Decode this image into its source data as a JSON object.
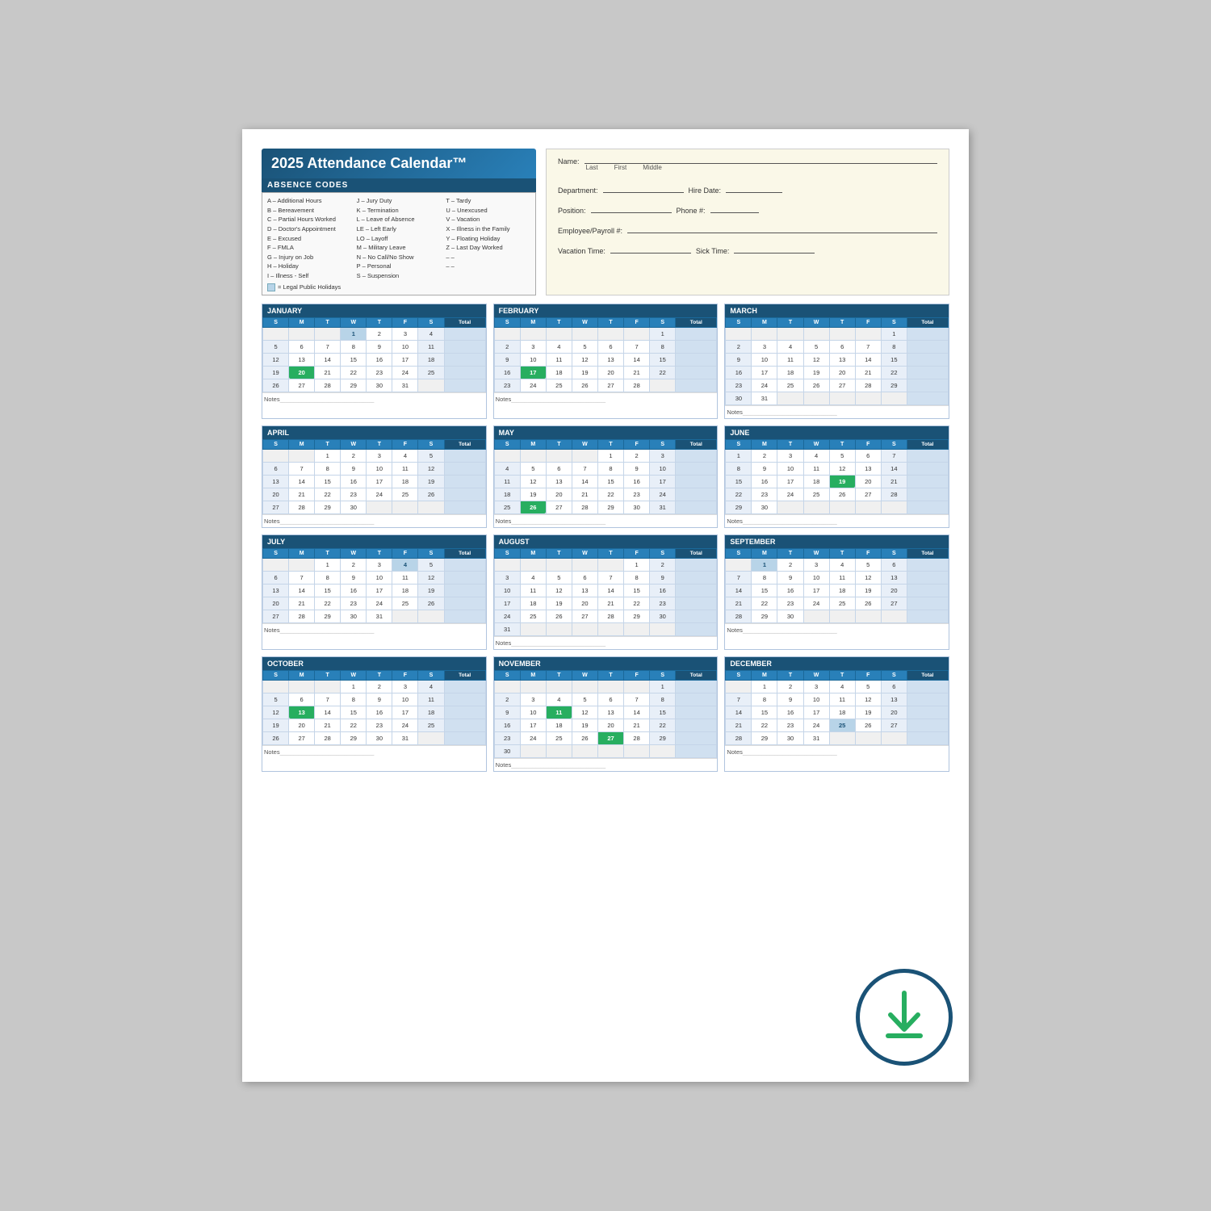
{
  "title": "2025 Attendance Calendar™",
  "absence_codes": {
    "header": "ABSENCE CODES",
    "col1": [
      "A – Additional Hours",
      "B – Bereavement",
      "C – Partial Hours Worked",
      "D – Doctor's Appointment",
      "E – Excused",
      "F – FMLA",
      "G – Injury on Job",
      "H – Holiday",
      "I  – Illness - Self"
    ],
    "col2": [
      "J  – Jury Duty",
      "K – Termination",
      "L  – Leave of Absence",
      "LE – Left Early",
      "LO – Layoff",
      "M – Military Leave",
      "N – No Call/No Show",
      "P  – Personal",
      "S  – Suspension"
    ],
    "col3": [
      "T – Tardy",
      "U – Unexcused",
      "V – Vacation",
      "X – Illness in the Family",
      "Y – Floating Holiday",
      "Z – Last Day Worked",
      "– –",
      "– –"
    ],
    "holiday_note": "= Legal Public Holidays"
  },
  "form": {
    "name_label": "Name:",
    "last_label": "Last",
    "first_label": "First",
    "middle_label": "Middle",
    "dept_label": "Department:",
    "hire_label": "Hire Date:",
    "position_label": "Position:",
    "phone_label": "Phone #:",
    "emp_label": "Employee/Payroll #:",
    "vac_label": "Vacation Time:",
    "sick_label": "Sick Time:"
  },
  "months": [
    {
      "name": "JANUARY",
      "weeks": [
        [
          "",
          "",
          "",
          "1",
          "2",
          "3",
          "4"
        ],
        [
          "5",
          "6",
          "7",
          "8",
          "9",
          "10",
          "11"
        ],
        [
          "12",
          "13",
          "14",
          "15",
          "16",
          "17",
          "18"
        ],
        [
          "19",
          "20",
          "21",
          "22",
          "23",
          "24",
          "25"
        ],
        [
          "26",
          "27",
          "28",
          "29",
          "30",
          "31",
          ""
        ]
      ],
      "highlights": [
        "1"
      ],
      "green_highlights": [
        "20"
      ]
    },
    {
      "name": "FEBRUARY",
      "weeks": [
        [
          "",
          "",
          "",
          "",
          "",
          "",
          "1"
        ],
        [
          "2",
          "3",
          "4",
          "5",
          "6",
          "7",
          "8"
        ],
        [
          "9",
          "10",
          "11",
          "12",
          "13",
          "14",
          "15"
        ],
        [
          "16",
          "17",
          "18",
          "19",
          "20",
          "21",
          "22"
        ],
        [
          "23",
          "24",
          "25",
          "26",
          "27",
          "28",
          ""
        ]
      ],
      "highlights": [],
      "green_highlights": [
        "17"
      ]
    },
    {
      "name": "MARCH",
      "weeks": [
        [
          "",
          "",
          "",
          "",
          "",
          "",
          "1"
        ],
        [
          "2",
          "3",
          "4",
          "5",
          "6",
          "7",
          "8"
        ],
        [
          "9",
          "10",
          "11",
          "12",
          "13",
          "14",
          "15"
        ],
        [
          "16",
          "17",
          "18",
          "19",
          "20",
          "21",
          "22"
        ],
        [
          "23",
          "24",
          "25",
          "26",
          "27",
          "28",
          "29"
        ],
        [
          "30",
          "31",
          "",
          "",
          "",
          "",
          ""
        ]
      ],
      "highlights": [],
      "green_highlights": []
    },
    {
      "name": "APRIL",
      "weeks": [
        [
          "",
          "",
          "1",
          "2",
          "3",
          "4",
          "5"
        ],
        [
          "6",
          "7",
          "8",
          "9",
          "10",
          "11",
          "12"
        ],
        [
          "13",
          "14",
          "15",
          "16",
          "17",
          "18",
          "19"
        ],
        [
          "20",
          "21",
          "22",
          "23",
          "24",
          "25",
          "26"
        ],
        [
          "27",
          "28",
          "29",
          "30",
          "",
          "",
          ""
        ]
      ],
      "highlights": [],
      "green_highlights": []
    },
    {
      "name": "MAY",
      "weeks": [
        [
          "",
          "",
          "",
          "",
          "1",
          "2",
          "3"
        ],
        [
          "4",
          "5",
          "6",
          "7",
          "8",
          "9",
          "10"
        ],
        [
          "11",
          "12",
          "13",
          "14",
          "15",
          "16",
          "17"
        ],
        [
          "18",
          "19",
          "20",
          "21",
          "22",
          "23",
          "24"
        ],
        [
          "25",
          "26",
          "27",
          "28",
          "29",
          "30",
          "31"
        ]
      ],
      "highlights": [],
      "green_highlights": [
        "26"
      ]
    },
    {
      "name": "JUNE",
      "weeks": [
        [
          "1",
          "2",
          "3",
          "4",
          "5",
          "6",
          "7"
        ],
        [
          "8",
          "9",
          "10",
          "11",
          "12",
          "13",
          "14"
        ],
        [
          "15",
          "16",
          "17",
          "18",
          "19",
          "20",
          "21"
        ],
        [
          "22",
          "23",
          "24",
          "25",
          "26",
          "27",
          "28"
        ],
        [
          "29",
          "30",
          "",
          "",
          "",
          "",
          ""
        ]
      ],
      "highlights": [],
      "green_highlights": [
        "19"
      ]
    },
    {
      "name": "JULY",
      "weeks": [
        [
          "",
          "",
          "1",
          "2",
          "3",
          "4",
          "5"
        ],
        [
          "6",
          "7",
          "8",
          "9",
          "10",
          "11",
          "12"
        ],
        [
          "13",
          "14",
          "15",
          "16",
          "17",
          "18",
          "19"
        ],
        [
          "20",
          "21",
          "22",
          "23",
          "24",
          "25",
          "26"
        ],
        [
          "27",
          "28",
          "29",
          "30",
          "31",
          "",
          ""
        ]
      ],
      "highlights": [
        "4"
      ],
      "green_highlights": []
    },
    {
      "name": "AUGUST",
      "weeks": [
        [
          "",
          "",
          "",
          "",
          "",
          "1",
          "2"
        ],
        [
          "3",
          "4",
          "5",
          "6",
          "7",
          "8",
          "9"
        ],
        [
          "10",
          "11",
          "12",
          "13",
          "14",
          "15",
          "16"
        ],
        [
          "17",
          "18",
          "19",
          "20",
          "21",
          "22",
          "23"
        ],
        [
          "24",
          "25",
          "26",
          "27",
          "28",
          "29",
          "30"
        ],
        [
          "31",
          "",
          "",
          "",
          "",
          "",
          ""
        ]
      ],
      "highlights": [],
      "green_highlights": []
    },
    {
      "name": "SEPTEMBER",
      "weeks": [
        [
          "",
          "1",
          "2",
          "3",
          "4",
          "5",
          "6"
        ],
        [
          "7",
          "8",
          "9",
          "10",
          "11",
          "12",
          "13"
        ],
        [
          "14",
          "15",
          "16",
          "17",
          "18",
          "19",
          "20"
        ],
        [
          "21",
          "22",
          "23",
          "24",
          "25",
          "26",
          "27"
        ],
        [
          "28",
          "29",
          "30",
          "",
          "",
          "",
          ""
        ]
      ],
      "highlights": [
        "1"
      ],
      "green_highlights": []
    },
    {
      "name": "OCTOBER",
      "weeks": [
        [
          "",
          "",
          "",
          "1",
          "2",
          "3",
          "4"
        ],
        [
          "5",
          "6",
          "7",
          "8",
          "9",
          "10",
          "11"
        ],
        [
          "12",
          "13",
          "14",
          "15",
          "16",
          "17",
          "18"
        ],
        [
          "19",
          "20",
          "21",
          "22",
          "23",
          "24",
          "25"
        ],
        [
          "26",
          "27",
          "28",
          "29",
          "30",
          "31",
          ""
        ]
      ],
      "highlights": [],
      "green_highlights": [
        "13"
      ]
    },
    {
      "name": "NOVEMBER",
      "weeks": [
        [
          "",
          "",
          "",
          "",
          "",
          "",
          "1"
        ],
        [
          "2",
          "3",
          "4",
          "5",
          "6",
          "7",
          "8"
        ],
        [
          "9",
          "10",
          "11",
          "12",
          "13",
          "14",
          "15"
        ],
        [
          "16",
          "17",
          "18",
          "19",
          "20",
          "21",
          "22"
        ],
        [
          "23",
          "24",
          "25",
          "26",
          "27",
          "28",
          "29"
        ],
        [
          "30",
          "",
          "",
          "",
          "",
          "",
          ""
        ]
      ],
      "highlights": [],
      "green_highlights": [
        "11",
        "27"
      ]
    },
    {
      "name": "DECEMBER",
      "weeks": [
        [
          "",
          "1",
          "2",
          "3",
          "4",
          "5",
          "6"
        ],
        [
          "7",
          "8",
          "9",
          "10",
          "11",
          "12",
          "13"
        ],
        [
          "14",
          "15",
          "16",
          "17",
          "18",
          "19",
          "20"
        ],
        [
          "21",
          "22",
          "23",
          "24",
          "25",
          "26",
          "27"
        ],
        [
          "28",
          "29",
          "30",
          "31",
          "",
          "",
          ""
        ]
      ],
      "highlights": [
        "25"
      ],
      "green_highlights": []
    }
  ],
  "days_header": [
    "S",
    "M",
    "T",
    "W",
    "T",
    "F",
    "S",
    "Total"
  ],
  "notes_label": "Notes"
}
